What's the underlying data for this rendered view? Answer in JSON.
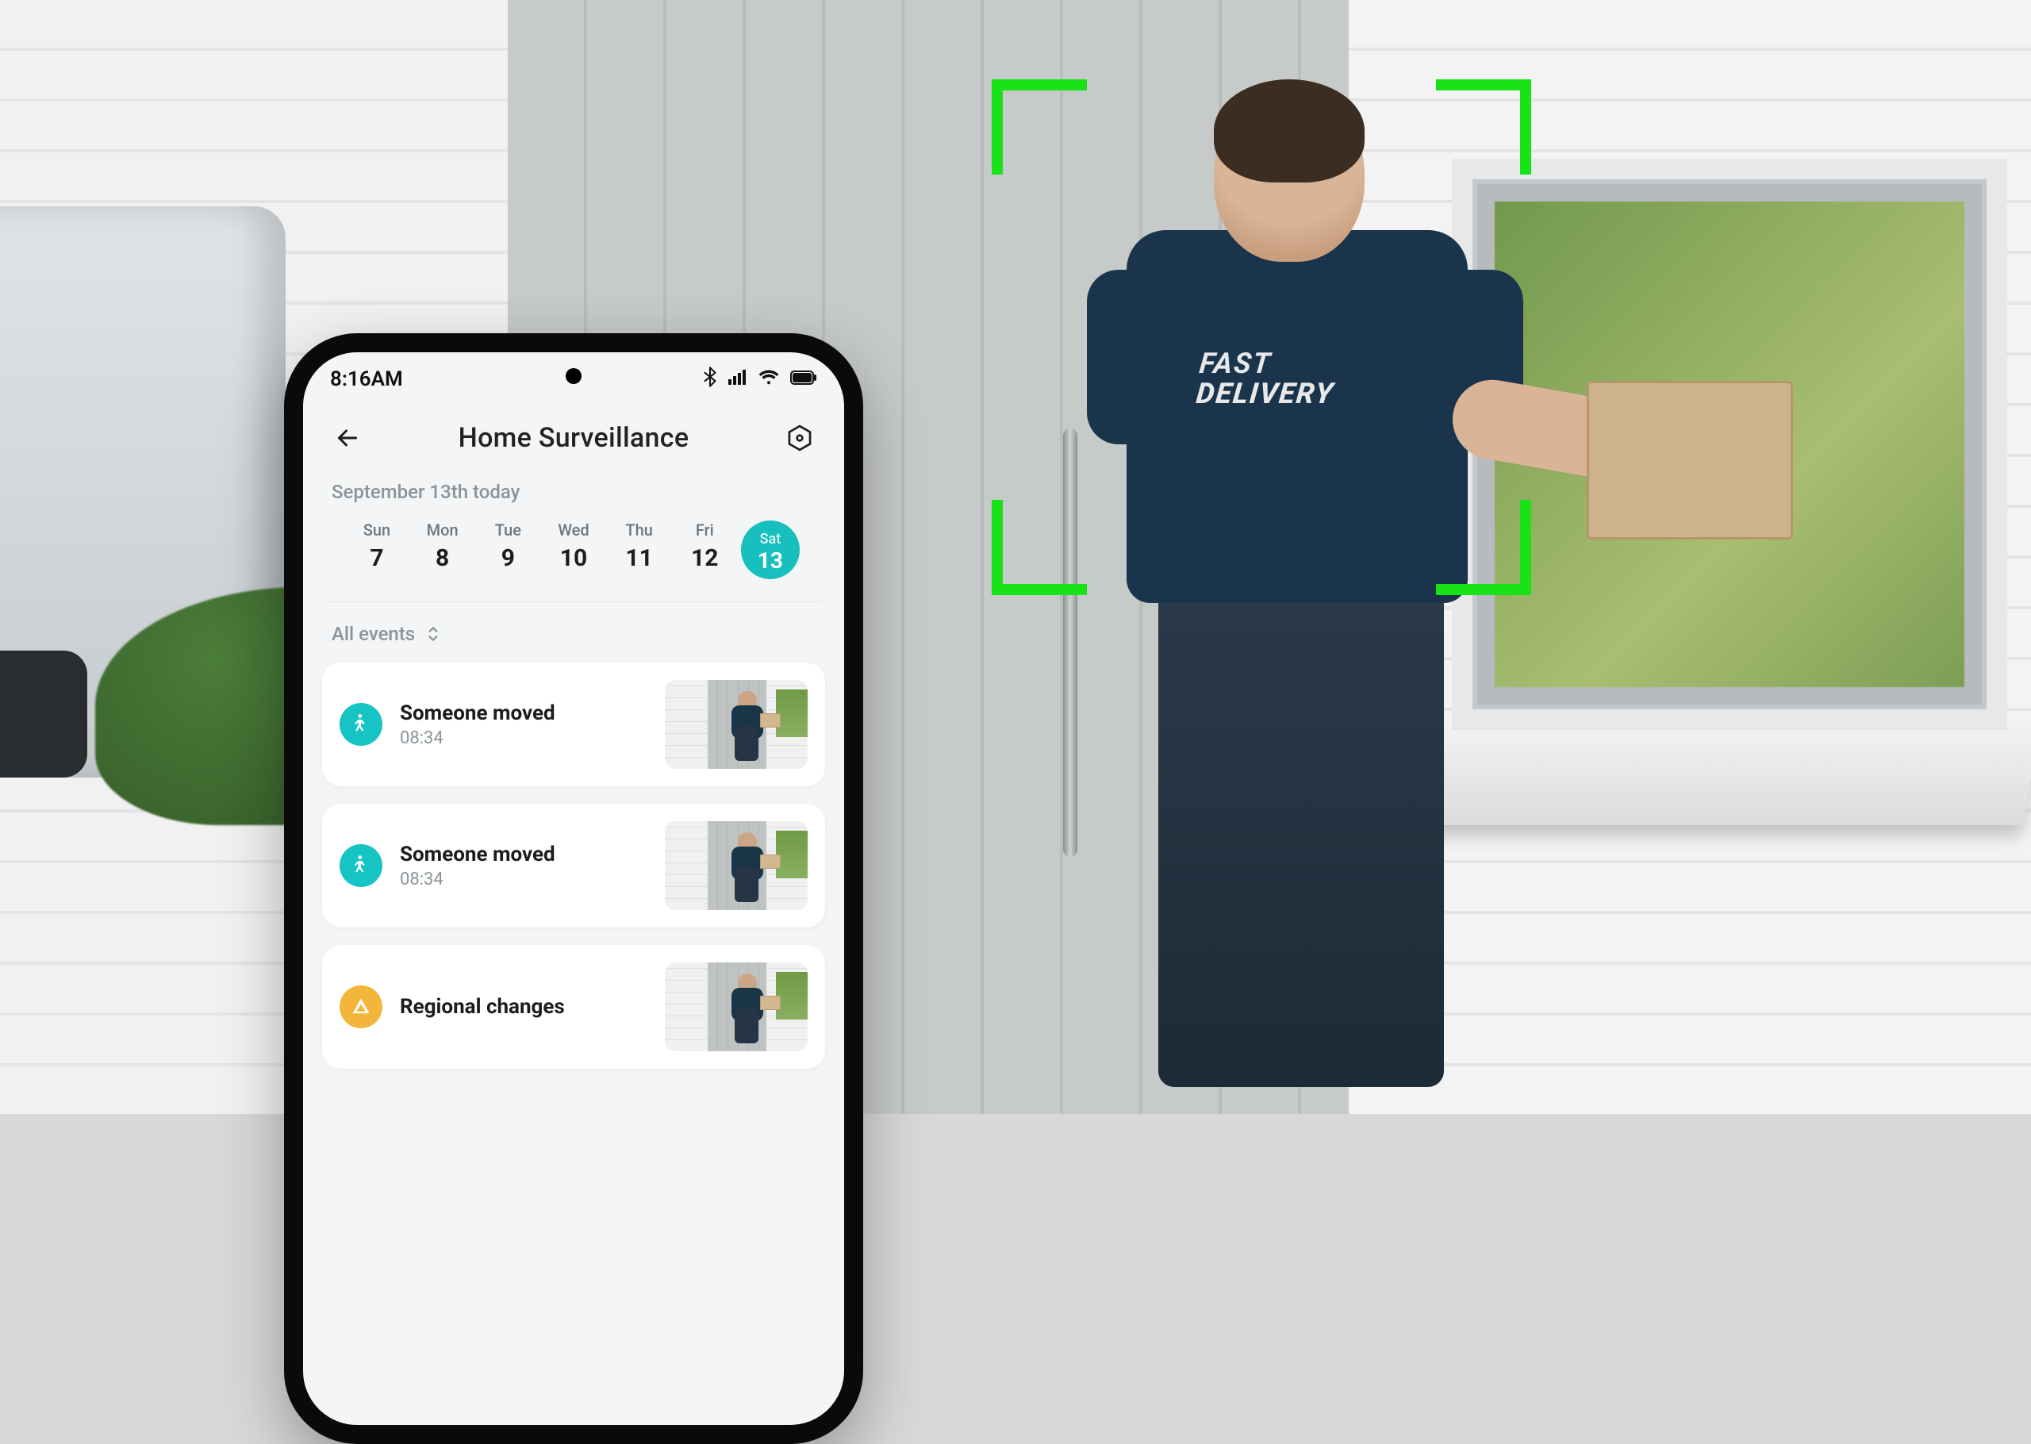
{
  "background": {
    "shirt_line1": "FAST",
    "shirt_line2": "DELIVERY"
  },
  "status_bar": {
    "time": "8:16AM"
  },
  "header": {
    "title": "Home Surveillance"
  },
  "date_header": "September 13th  today",
  "days": [
    {
      "dow": "Sun",
      "num": "7",
      "selected": false
    },
    {
      "dow": "Mon",
      "num": "8",
      "selected": false
    },
    {
      "dow": "Tue",
      "num": "9",
      "selected": false
    },
    {
      "dow": "Wed",
      "num": "10",
      "selected": false
    },
    {
      "dow": "Thu",
      "num": "11",
      "selected": false
    },
    {
      "dow": "Fri",
      "num": "12",
      "selected": false
    },
    {
      "dow": "Sat",
      "num": "13",
      "selected": true
    }
  ],
  "filter_label": "All events",
  "events": [
    {
      "icon": "motion",
      "title": "Someone moved",
      "time": "08:34"
    },
    {
      "icon": "motion",
      "title": "Someone moved",
      "time": "08:34"
    },
    {
      "icon": "region",
      "title": "Regional changes",
      "time": ""
    }
  ],
  "colors": {
    "accent": "#17bfbf",
    "warning": "#f3b63a",
    "detect": "#18e218"
  }
}
